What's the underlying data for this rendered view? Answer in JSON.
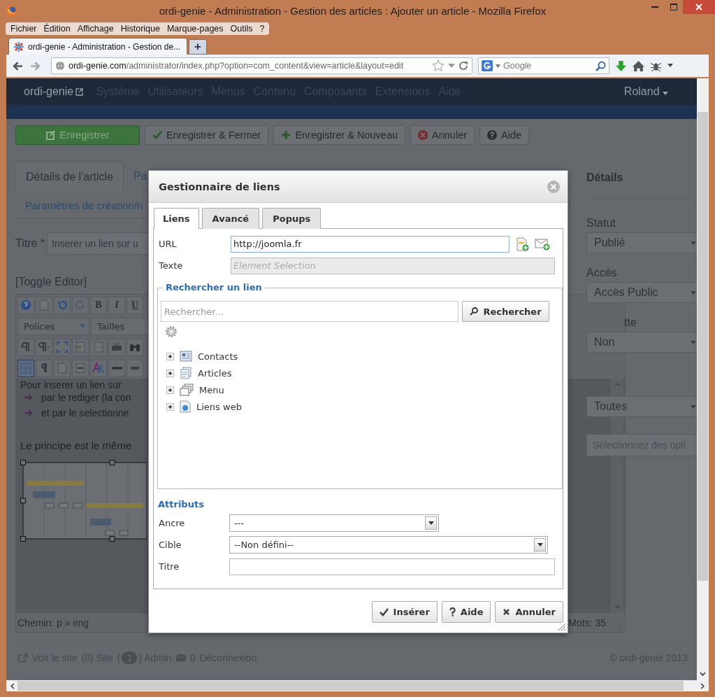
{
  "window": {
    "title": "ordi-genie - Administration - Gestion des articles : Ajouter un article - Mozilla Firefox"
  },
  "menu_bar": [
    "Fichier",
    "Édition",
    "Affichage",
    "Historique",
    "Marque-pages",
    "Outils",
    "?"
  ],
  "browser_tabs": [
    {
      "label": "ordi-genie - Administration - Gestion de...",
      "selected": true
    }
  ],
  "new_tab": "+",
  "address_bar": {
    "domain": "ordi-genie.com",
    "path": "/administrator/index.php?option=com_content&view=article&layout=edit"
  },
  "search_bar": {
    "placeholder": "Google"
  },
  "admin_nav": {
    "brand": "ordi-genie",
    "items": [
      "Système",
      "Utilisateurs",
      "Menus",
      "Contenu",
      "Composants",
      "Extensions",
      "Aide"
    ],
    "user": "Roland"
  },
  "toolbar": [
    {
      "label": "Enregistrer",
      "kind": "save"
    },
    {
      "label": "Enregistrer & Fermer",
      "kind": "save-close"
    },
    {
      "label": "Enregistrer & Nouveau",
      "kind": "save-new"
    },
    {
      "label": "Annuler",
      "kind": "cancel"
    },
    {
      "label": "Aide",
      "kind": "help"
    }
  ],
  "article_tabs": [
    {
      "label": "Détails de l'article",
      "selected": true
    },
    {
      "label": "Pa",
      "selected": false
    },
    {
      "label": "Paramètres de création/n",
      "selected": false
    }
  ],
  "title_field": {
    "label": "Titre *",
    "value": "Inserer un lien sur u"
  },
  "toggle_editor": "[Toggle Editor]",
  "editor": {
    "format_buttons": [
      "B",
      "I",
      "U"
    ],
    "font_select": "Polices",
    "size_select": "Tailles",
    "lines": [
      {
        "kind": "text",
        "text": "Pour inserer un lien sur"
      },
      {
        "kind": "bullet",
        "text": "par le rediger (la con"
      },
      {
        "kind": "bullet",
        "text": "et par le selectionne"
      },
      {
        "kind": "paragraph",
        "text": "Le principe est le même"
      }
    ],
    "path": "Chemin: p » img",
    "word_count": "Mots: 35"
  },
  "sidebar": {
    "title": "Détails",
    "fields": [
      {
        "kind": "select",
        "label": "Statut",
        "value": "Publié"
      },
      {
        "kind": "select",
        "label": "Accès",
        "value": "Accès Public"
      },
      {
        "kind": "select",
        "label": "tte",
        "value": "Non"
      },
      {
        "kind": "select",
        "value": "Toutes"
      },
      {
        "kind": "multiselect",
        "placeholder": "Sélectionnez des opti"
      }
    ]
  },
  "footer": {
    "view_site": "Voir le site",
    "site": "(0) Site",
    "admin_open": "(",
    "admin_count": "1",
    "admin": ") Admin",
    "messages": "0",
    "logout": "Déconnexion",
    "copyright": "© ordi-genie 2013"
  },
  "dialog": {
    "title": "Gestionnaire de liens",
    "tabs": [
      {
        "label": "Liens",
        "selected": true
      },
      {
        "label": "Avancé",
        "selected": false
      },
      {
        "label": "Popups",
        "selected": false
      }
    ],
    "url": {
      "label": "URL",
      "value": "http://joomla.fr"
    },
    "text": {
      "label": "Texte",
      "placeholder": "Element Selection",
      "disabled": true
    },
    "search": {
      "legend": "Rechercher un lien",
      "placeholder": "Rechercher...",
      "button": "Rechercher"
    },
    "tree": [
      {
        "label": "Contacts",
        "kind": "contacts",
        "expanded": false
      },
      {
        "label": "Articles",
        "kind": "articles",
        "expanded": false
      },
      {
        "label": "Menu",
        "kind": "menu",
        "expanded": false
      },
      {
        "label": "Liens web",
        "kind": "weblinks",
        "expanded": false
      }
    ],
    "attributes": {
      "legend": "Attributs",
      "anchor": {
        "label": "Ancre",
        "value": "---"
      },
      "target": {
        "label": "Cible",
        "value": "--Non défini--"
      },
      "title": {
        "label": "Titre"
      }
    },
    "buttons": [
      {
        "label": "Insérer",
        "kind": "insert"
      },
      {
        "label": "Aide",
        "kind": "help"
      },
      {
        "label": "Annuler",
        "kind": "cancel"
      }
    ]
  }
}
